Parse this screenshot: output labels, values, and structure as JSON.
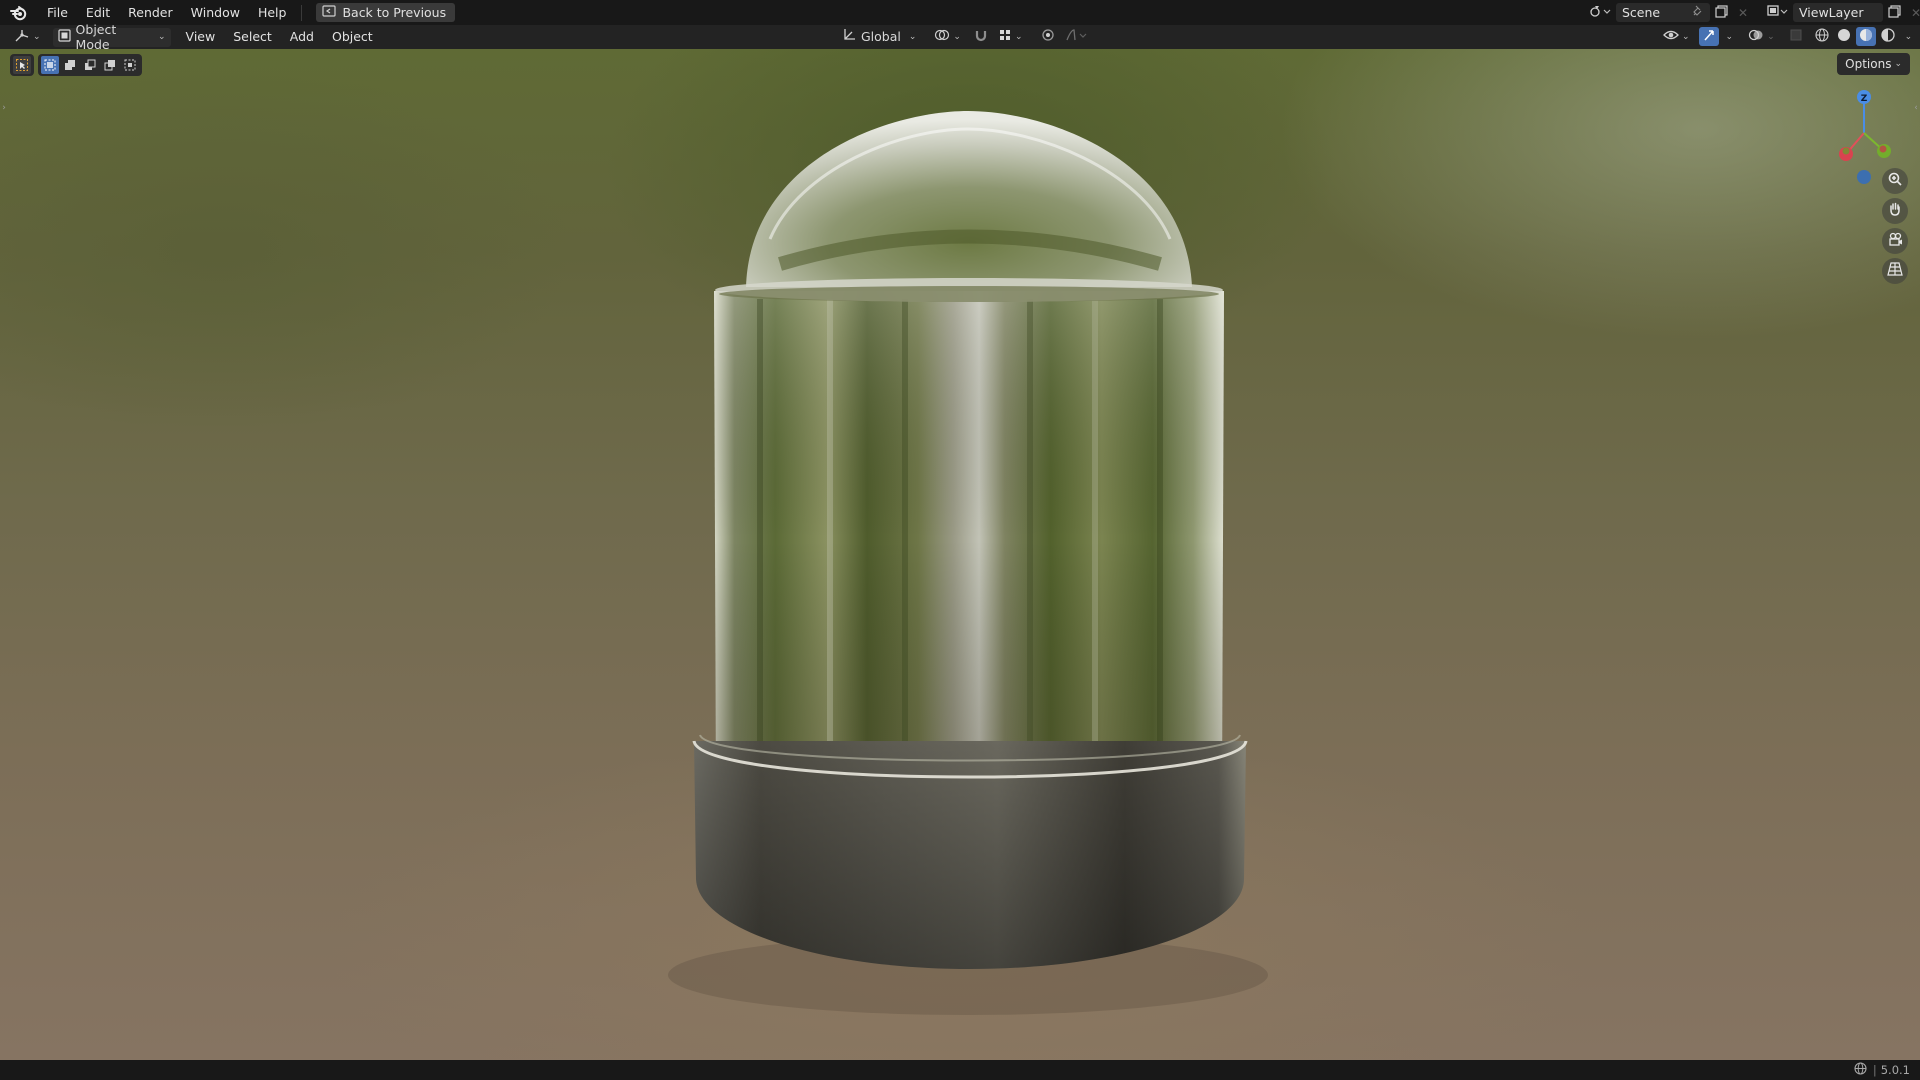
{
  "topbar": {
    "menus": [
      "File",
      "Edit",
      "Render",
      "Window",
      "Help"
    ],
    "back_button": "Back to Previous",
    "scene": "Scene",
    "view_layer": "ViewLayer"
  },
  "header": {
    "mode": "Object Mode",
    "menus": [
      "View",
      "Select",
      "Add",
      "Object"
    ],
    "transform_orientation": "Global"
  },
  "viewport": {
    "options_label": "Options",
    "gizmo_axis_label": "Z",
    "accent_color": "#4772b3"
  },
  "statusbar": {
    "version": "5.0.1"
  }
}
